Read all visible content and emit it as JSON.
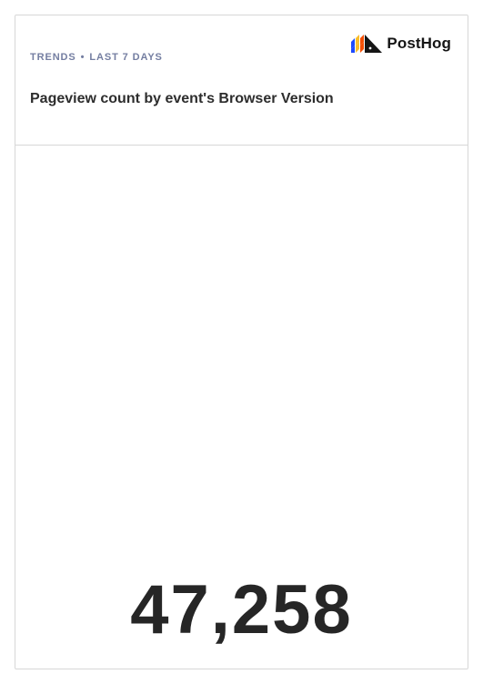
{
  "insight": {
    "type_label": "TRENDS",
    "separator": "•",
    "range_label": "LAST 7 DAYS",
    "title": "Pageview count by event's Browser Version",
    "value": "47,258"
  },
  "brand": {
    "name": "PostHog",
    "logo_icon": "posthog-hedgehog-logo",
    "colors": {
      "blue": "#1d4aff",
      "orange": "#f54e00",
      "yellow": "#f9bd2b",
      "black": "#151515"
    }
  }
}
